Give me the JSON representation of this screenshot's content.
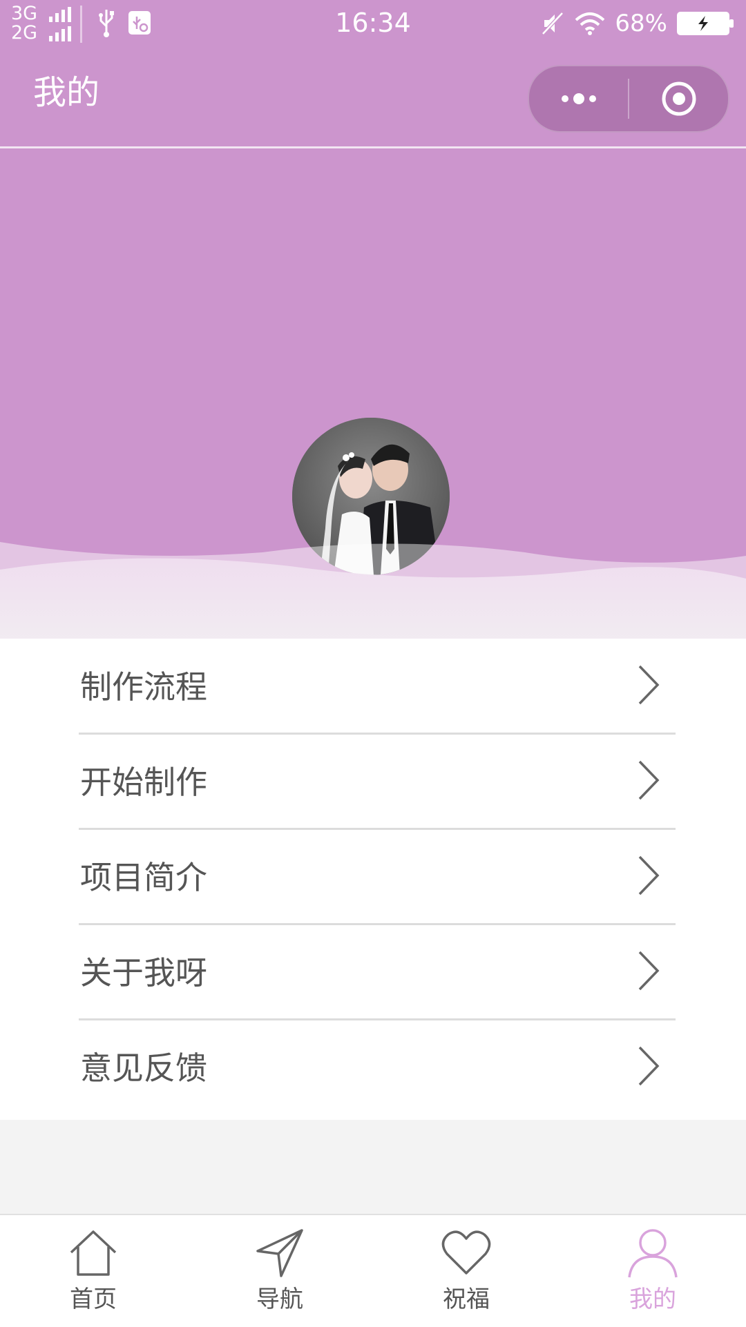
{
  "status_bar": {
    "network_1": "3G",
    "network_2": "2G",
    "time": "16:34",
    "battery": "68%",
    "icons": [
      "signal-icon",
      "usb-icon",
      "usb-settings-icon",
      "mute-icon",
      "wifi-icon",
      "battery-charging-icon"
    ]
  },
  "nav": {
    "title": "我的",
    "more_icon": "more-dots-icon",
    "close_icon": "target-circle-icon"
  },
  "profile": {
    "avatar": "wedding-couple-photo"
  },
  "menu": {
    "items": [
      {
        "label": "制作流程"
      },
      {
        "label": "开始制作"
      },
      {
        "label": "项目简介"
      },
      {
        "label": "关于我呀"
      },
      {
        "label": "意见反馈"
      }
    ]
  },
  "tabbar": {
    "items": [
      {
        "label": "首页",
        "icon": "home-icon"
      },
      {
        "label": "导航",
        "icon": "navigation-arrow-icon"
      },
      {
        "label": "祝福",
        "icon": "heart-icon"
      },
      {
        "label": "我的",
        "icon": "person-icon"
      }
    ],
    "active": 3
  },
  "colors": {
    "theme": "#cc95cd",
    "active_tab": "#d9a3dc",
    "text": "#555555",
    "background": "#f3f3f3"
  }
}
